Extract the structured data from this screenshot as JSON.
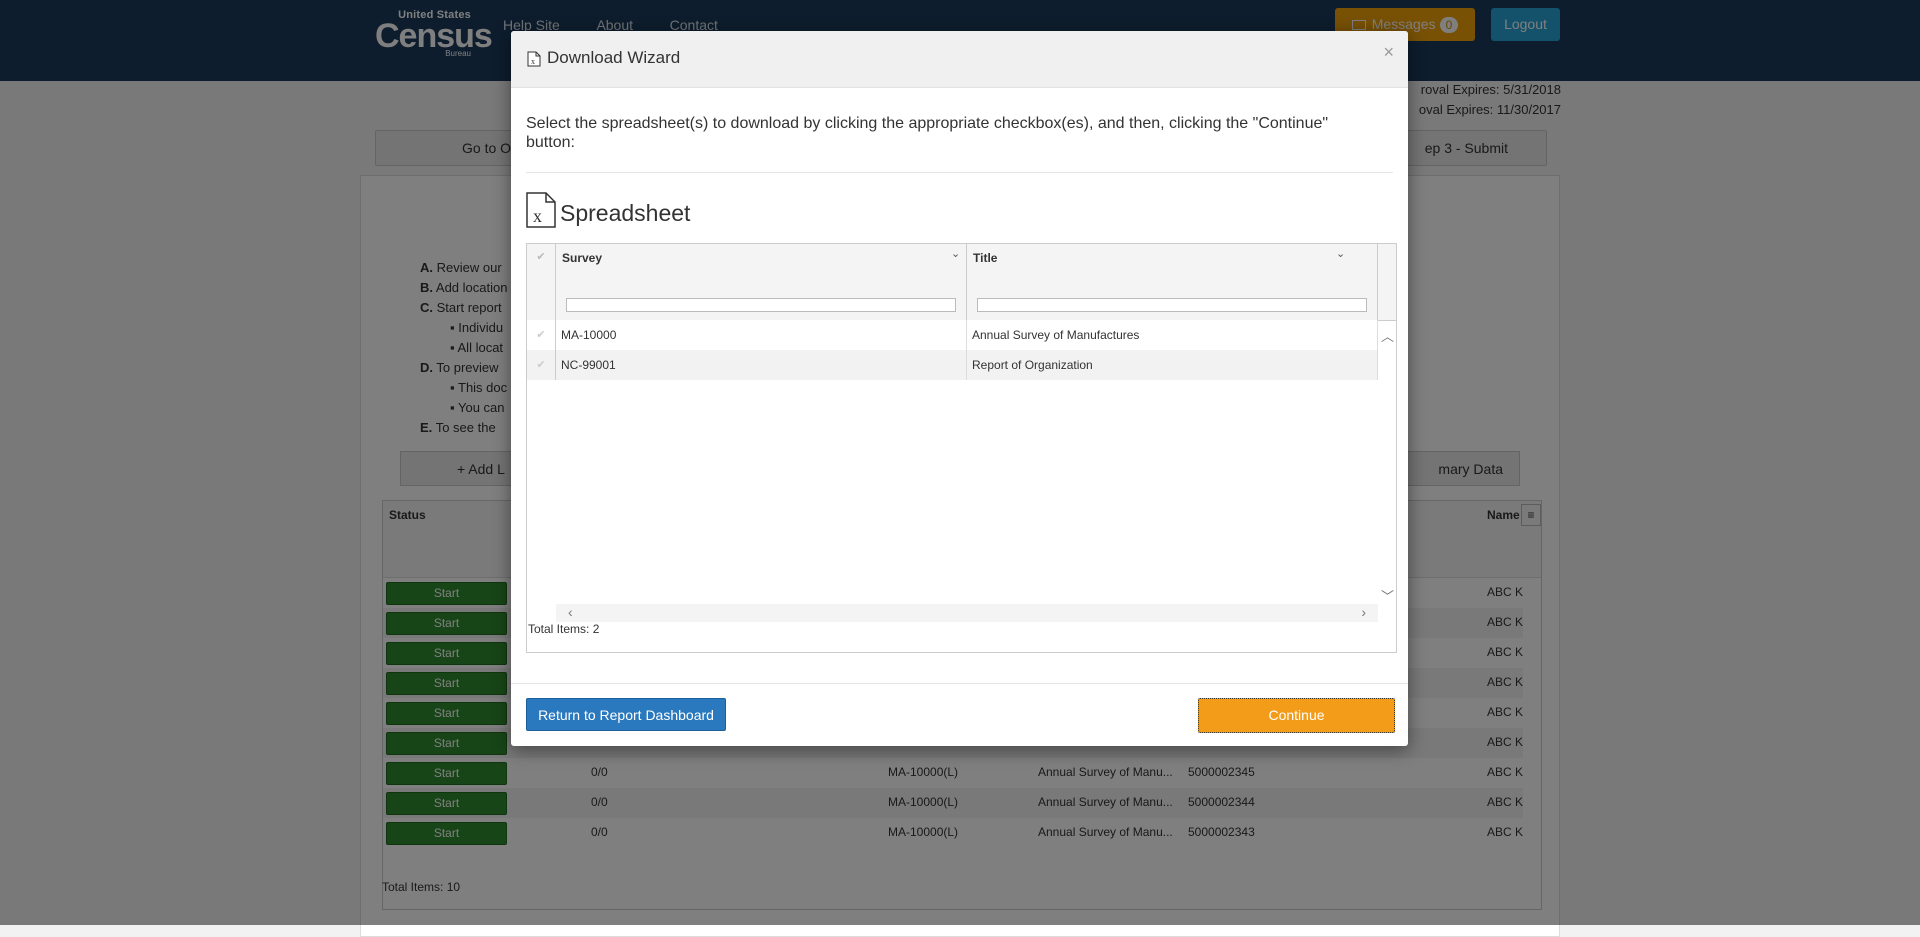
{
  "header": {
    "logo": {
      "line1": "United States",
      "line2": "Census",
      "line3": "Bureau"
    },
    "nav": [
      "Help Site",
      "About",
      "Contact"
    ],
    "messages_label": "Messages",
    "messages_count": "0",
    "logout_label": "Logout",
    "approval_line1": "roval Expires: 5/31/2018",
    "approval_line2": "oval Expires: 11/30/2017"
  },
  "background": {
    "steps_left": "Go to O",
    "steps_right": "ep 3 - Submit",
    "instructions": [
      {
        "label": "A.",
        "text": "Review our"
      },
      {
        "label": "B.",
        "text": "Add location"
      },
      {
        "label": "C.",
        "text": "Start report"
      },
      {
        "label": "▪",
        "text": "Individu"
      },
      {
        "label": "▪",
        "text": "All locat"
      },
      {
        "label": "D.",
        "text": "To preview"
      },
      {
        "label": "▪",
        "text": "This doc"
      },
      {
        "label": "▪",
        "text": "You can"
      },
      {
        "label": "E.",
        "text": "To see the"
      }
    ],
    "add_button_left": "+ Add L",
    "add_button_right": "mary Data",
    "grid_header_status": "Status",
    "grid_header_name": "Name",
    "start_label": "Start",
    "rows": [
      {
        "c1": "",
        "c2": "",
        "c3": "",
        "c4": "",
        "c5": "",
        "c6": "ABC K"
      },
      {
        "c1": "",
        "c2": "",
        "c3": "",
        "c4": "",
        "c5": "",
        "c6": "ABC K"
      },
      {
        "c1": "",
        "c2": "",
        "c3": "",
        "c4": "",
        "c5": "",
        "c6": "ABC K"
      },
      {
        "c1": "",
        "c2": "",
        "c3": "",
        "c4": "",
        "c5": "",
        "c6": "ABC K"
      },
      {
        "c1": "",
        "c2": "",
        "c3": "",
        "c4": "",
        "c5": "",
        "c6": "ABC K"
      },
      {
        "c1": "",
        "c2": "",
        "c3": "",
        "c4": "",
        "c5": "",
        "c6": "ABC K"
      },
      {
        "c1": "0/0",
        "c2": "",
        "c3": "MA-10000(L)",
        "c4": "Annual Survey of Manu...",
        "c5": "5000002345",
        "c6": "ABC K"
      },
      {
        "c1": "0/0",
        "c2": "",
        "c3": "MA-10000(L)",
        "c4": "Annual Survey of Manu...",
        "c5": "5000002344",
        "c6": "ABC K"
      },
      {
        "c1": "0/0",
        "c2": "",
        "c3": "MA-10000(L)",
        "c4": "Annual Survey of Manu...",
        "c5": "5000002343",
        "c6": "ABC K"
      }
    ],
    "total_items": "Total Items: 10"
  },
  "modal": {
    "title": "Download Wizard",
    "close": "×",
    "intro": "Select the spreadsheet(s) to download by clicking the appropriate checkbox(es), and then, clicking the \"Continue\" button:",
    "section_title": "Spreadsheet",
    "columns": [
      {
        "label": "Survey"
      },
      {
        "label": "Title"
      }
    ],
    "rows": [
      {
        "survey": "MA-10000",
        "title": "Annual Survey of Manufactures"
      },
      {
        "survey": "NC-99001",
        "title": "Report of Organization"
      }
    ],
    "total_items": "Total Items: 2",
    "return_label": "Return to Report Dashboard",
    "continue_label": "Continue"
  }
}
